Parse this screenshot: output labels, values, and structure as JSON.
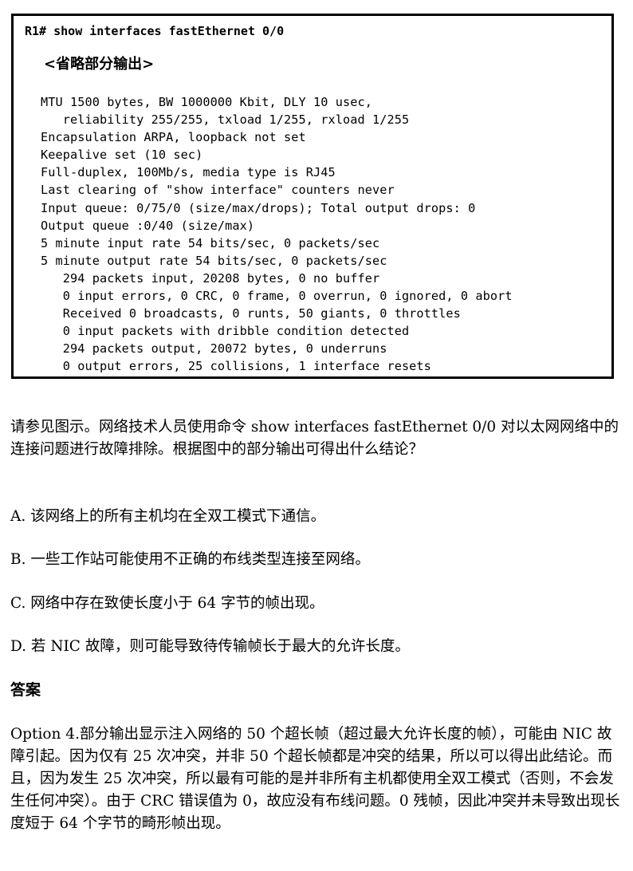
{
  "terminal": {
    "command": "R1# show interfaces fastEthernet 0/0",
    "omitted_note": "<省略部分输出>",
    "lines": [
      "MTU 1500 bytes, BW 1000000 Kbit, DLY 10 usec,",
      "   reliability 255/255, txload 1/255, rxload 1/255",
      "Encapsulation ARPA, loopback not set",
      "Keepalive set (10 sec)",
      "Full-duplex, 100Mb/s, media type is RJ45",
      "Last clearing of \"show interface\" counters never",
      "Input queue: 0/75/0 (size/max/drops); Total output drops: 0",
      "Output queue :0/40 (size/max)",
      "5 minute input rate 54 bits/sec, 0 packets/sec",
      "5 minute output rate 54 bits/sec, 0 packets/sec",
      "   294 packets input, 20208 bytes, 0 no buffer",
      "   0 input errors, 0 CRC, 0 frame, 0 overrun, 0 ignored, 0 abort",
      "   Received 0 broadcasts, 0 runts, 50 giants, 0 throttles",
      "   0 input packets with dribble condition detected",
      "   294 packets output, 20072 bytes, 0 underruns",
      "   0 output errors, 25 collisions, 1 interface resets"
    ]
  },
  "question": "请参见图示。网络技术人员使用命令 show interfaces fastEthernet 0/0 对以太网网络中的连接问题进行故障排除。根据图中的部分输出可得出什么结论？",
  "options": [
    "A. 该网络上的所有主机均在全双工模式下通信。",
    "B. 一些工作站可能使用不正确的布线类型连接至网络。",
    "C. 网络中存在致使长度小于 64 字节的帧出现。",
    "D. 若 NIC 故障，则可能导致待传输帧长于最大的允许长度。"
  ],
  "answer_heading": "答案",
  "explanation": "Option 4.部分输出显示注入网络的 50 个超长帧（超过最大允许长度的帧），可能由 NIC 故障引起。因为仅有 25 次冲突，并非 50 个超长帧都是冲突的结果，所以可以得出此结论。而且，因为发生 25 次冲突，所以最有可能的是并非所有主机都使用全双工模式（否则，不会发生任何冲突）。由于 CRC 错误值为 0，故应没有布线问题。0 残帧，因此冲突并未导致出现长度短于 64 个字节的畸形帧出现。"
}
